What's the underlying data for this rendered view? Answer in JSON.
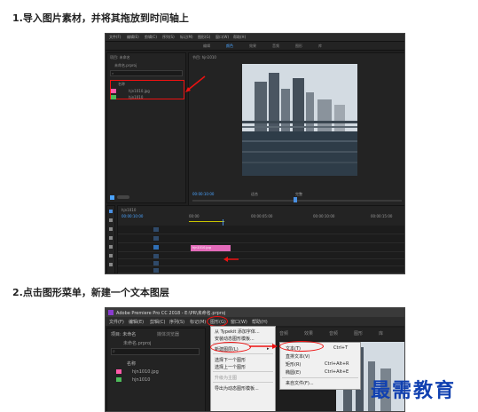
{
  "step1": {
    "title": "1.导入图片素材，并将其拖放到时间轴上",
    "menu_items": [
      "文件(F)",
      "编辑(E)",
      "剪辑(C)",
      "序列(S)",
      "标记(M)",
      "图形(G)",
      "窗口(W)",
      "帮助(H)"
    ],
    "workspace_tabs": [
      "编辑",
      "颜色",
      "效果",
      "音频",
      "图形",
      "库"
    ],
    "project_panel_title": "项目: 未命名",
    "project_file": "未命名.prproj",
    "project_col_name": "名称",
    "project_items": [
      "hjn1010.jpg",
      "hjn1010"
    ],
    "program_tab": "节目: hjn1010",
    "timecode_program": "00:00:10:00",
    "fit_label": "适合",
    "full_label": "完整",
    "timecode_seq": "00:00:10:00",
    "seq_tab": "hjn1010",
    "ruler_marks": [
      "00:00",
      "00:00:05:00",
      "00:00:10:00",
      "00:00:15:00"
    ],
    "clip_label": "hjn1010.jpg",
    "colors": {
      "accent": "#4a90e2",
      "highlight": "#e11111",
      "clip": "#e36ab9",
      "label_pink": "#ff5aa8",
      "label_green": "#4dbb5a"
    }
  },
  "step2": {
    "title": "2.点击图形菜单，新建一个文本图层",
    "window_title": "Adobe Premiere Pro CC 2018 - E:\\PR\\未命名.prproj",
    "menu_items": [
      "文件(F)",
      "编辑(E)",
      "剪辑(C)",
      "序列(S)",
      "标记(M)",
      "图形(G)",
      "窗口(W)",
      "帮助(H)"
    ],
    "graphics_menu": [
      "从 Typekit 添加字体...",
      "安装动态图形模板...",
      "新建图层(L)",
      "选择下一个图形",
      "选择上一个图形",
      "升级为主图",
      "导出为动态图形模板..."
    ],
    "new_layer_submenu": [
      {
        "label": "文本(T)",
        "shortcut": "Ctrl+T"
      },
      {
        "label": "直排文本(V)",
        "shortcut": ""
      },
      {
        "label": "矩形(R)",
        "shortcut": "Ctrl+Alt+R"
      },
      {
        "label": "椭圆(E)",
        "shortcut": "Ctrl+Alt+E"
      },
      {
        "label": "来自文件(F)...",
        "shortcut": ""
      }
    ],
    "workspace_tabs": [
      "音频",
      "效果",
      "音频",
      "图形",
      "库"
    ],
    "project_panel_title": "项目: 未命名",
    "media_tab": "媒体浏览器",
    "project_file": "未命名.prproj",
    "project_col_name": "名称",
    "project_items": [
      "hjn1010.jpg",
      "hjn1010"
    ]
  },
  "watermark": "最需教育"
}
